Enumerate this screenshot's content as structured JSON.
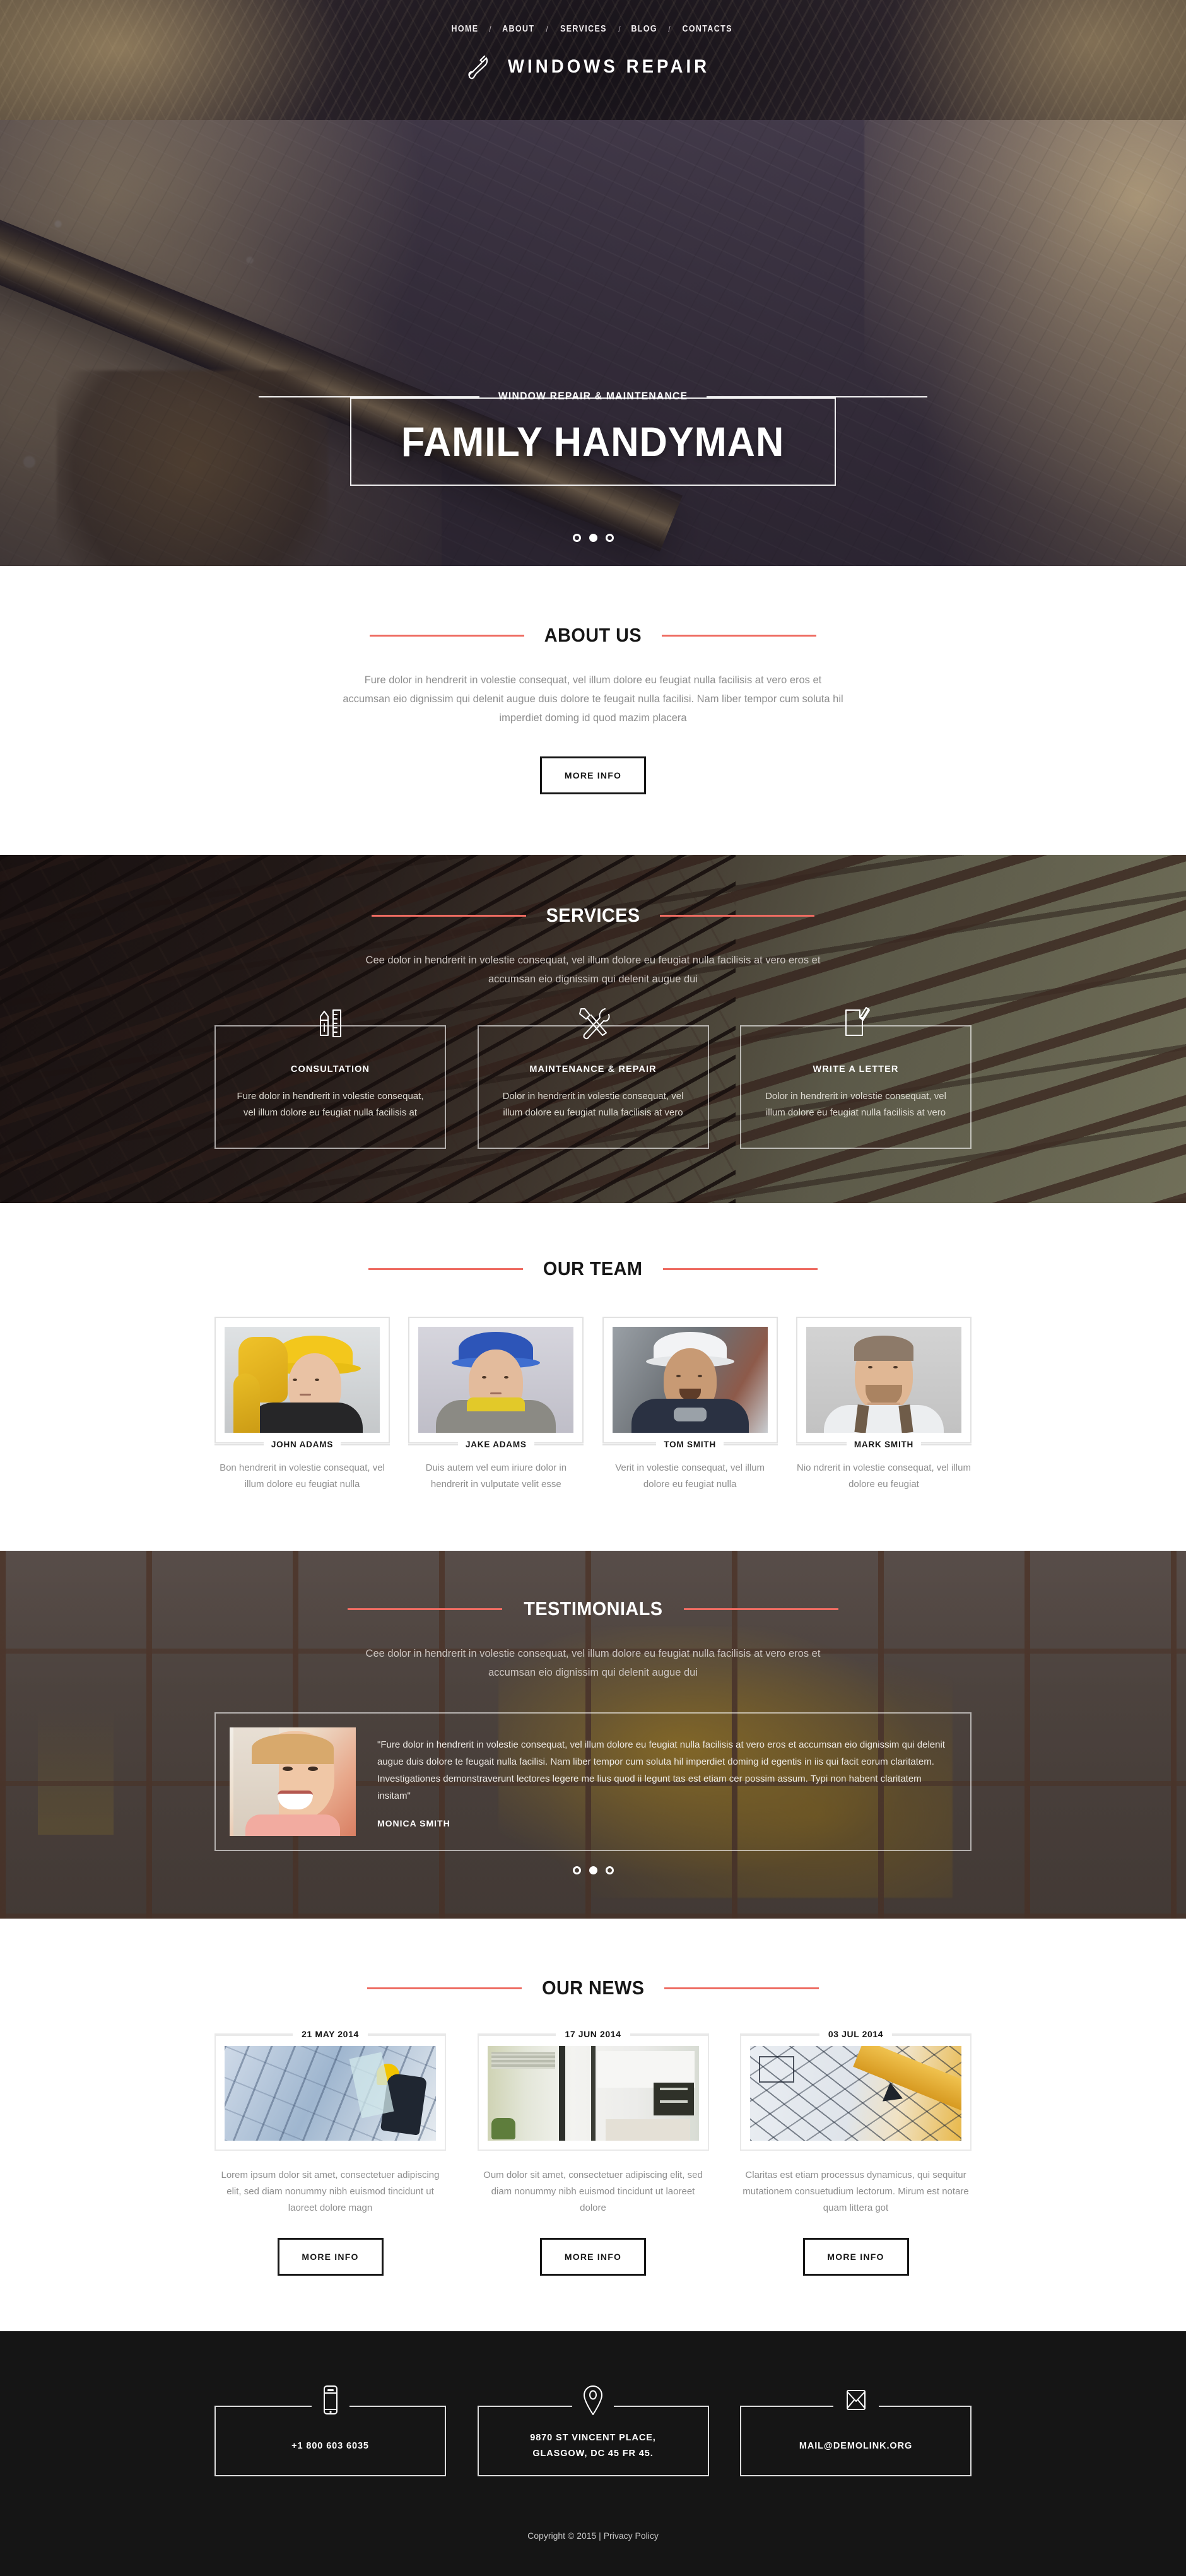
{
  "header": {
    "nav": [
      {
        "label": "HOME"
      },
      {
        "label": "ABOUT"
      },
      {
        "label": "SERVICES"
      },
      {
        "label": "BLOG"
      },
      {
        "label": "CONTACTS"
      }
    ],
    "separator": "/",
    "brand": "WINDOWS REPAIR",
    "logo_icon": "wrench-icon"
  },
  "hero": {
    "subtitle": "WINDOW REPAIR & MAINTENANCE",
    "title": "FAMILY HANDYMAN",
    "dots": [
      {
        "active": false
      },
      {
        "active": true
      },
      {
        "active": false
      }
    ]
  },
  "about": {
    "title": "ABOUT US",
    "lead": "Fure dolor in hendrerit in volestie consequat, vel illum dolore eu feugiat nulla facilisis at vero eros et accumsan eio dignissim qui  delenit augue duis dolore te feugait nulla facilisi. Nam liber tempor cum soluta hil imperdiet doming id quod mazim placera",
    "button": "MORE INFO"
  },
  "services": {
    "title": "SERVICES",
    "lead": "Cee dolor in hendrerit in volestie consequat, vel illum dolore eu feugiat nulla facilisis at vero eros et accumsan eio dignissim qui  delenit augue dui",
    "cards": [
      {
        "icon": "pencil-ruler-icon",
        "title": "CONSULTATION",
        "text": "Fure dolor in hendrerit in volestie consequat, vel illum dolore eu feugiat nulla facilisis at"
      },
      {
        "icon": "wrench-screwdriver-icon",
        "title": "MAINTENANCE & REPAIR",
        "text": "Dolor in hendrerit in volestie consequat, vel illum dolore eu feugiat nulla facilisis at vero"
      },
      {
        "icon": "write-letter-icon",
        "title": "WRITE A LETTER",
        "text": "Dolor in hendrerit in volestie consequat, vel illum dolore eu feugiat nulla facilisis at vero"
      }
    ]
  },
  "team": {
    "title": "OUR TEAM",
    "members": [
      {
        "name": "JOHN ADAMS",
        "text": "Bon hendrerit in volestie consequat, vel illum dolore eu feugiat nulla",
        "photo": "portrait-yellow-helmet"
      },
      {
        "name": "JAKE ADAMS",
        "text": "Duis autem vel eum iriure dolor in hendrerit in vulputate velit esse",
        "photo": "portrait-blue-helmet"
      },
      {
        "name": "TOM SMITH",
        "text": "Verit in volestie consequat, vel illum dolore eu feugiat nulla",
        "photo": "portrait-white-helmet"
      },
      {
        "name": "MARK SMITH",
        "text": "Nio ndrerit in volestie consequat, vel illum dolore eu feugiat",
        "photo": "portrait-overalls"
      }
    ]
  },
  "testimonials": {
    "title": "TESTIMONIALS",
    "lead": "Cee dolor in hendrerit in volestie consequat, vel illum dolore eu feugiat nulla facilisis at vero eros et accumsan eio dignissim qui  delenit augue dui",
    "quote": "\"Fure dolor in hendrerit in volestie consequat, vel illum dolore eu feugiat nulla facilisis at vero eros et accumsan eio dignissim qui  delenit augue duis dolore te feugait nulla facilisi. Nam liber tempor cum soluta hil imperdiet doming id egentis in iis qui facit eorum claritatem. Investigationes demonstraverunt lectores legere me lius quod ii legunt tas est etiam cer possim assum. Typi non habent claritatem insitam\"",
    "author": "MONICA SMITH",
    "photo": "portrait-smiling-woman",
    "dots": [
      {
        "active": false
      },
      {
        "active": true
      },
      {
        "active": false
      }
    ]
  },
  "news": {
    "title": "OUR NEWS",
    "posts": [
      {
        "date": "21 MAY 2014",
        "text": "Lorem ipsum dolor sit amet, consectetuer adipiscing elit, sed diam nonummy nibh euismod tincidunt ut laoreet dolore magn",
        "button": "MORE INFO",
        "photo": "window-cleaner-facade"
      },
      {
        "date": "17 JUN 2014",
        "text": "Oum dolor sit amet, consectetuer adipiscing elit, sed diam nonummy nibh euismod tincidunt ut laoreet dolore",
        "button": "MORE INFO",
        "photo": "modern-interior-kitchen"
      },
      {
        "date": "03 JUL 2014",
        "text": "Claritas est etiam processus dynamicus, qui sequitur mutationem consuetudium lectorum. Mirum est notare quam littera got",
        "button": "MORE INFO",
        "photo": "blueprint-pencil"
      }
    ]
  },
  "footer": {
    "contacts": [
      {
        "icon": "phone-icon",
        "text": "+1 800 603 6035"
      },
      {
        "icon": "map-pin-icon",
        "text": "9870 ST VINCENT PLACE,\nGLASGOW, DC 45 FR 45."
      },
      {
        "icon": "envelope-icon",
        "text": "MAIL@DEMOLINK.ORG"
      }
    ],
    "copyright": "Copyright © 2015 | Privacy Policy"
  },
  "colors": {
    "accent": "#ee6c62",
    "dark": "#151515",
    "muted": "#8e8e8e"
  }
}
